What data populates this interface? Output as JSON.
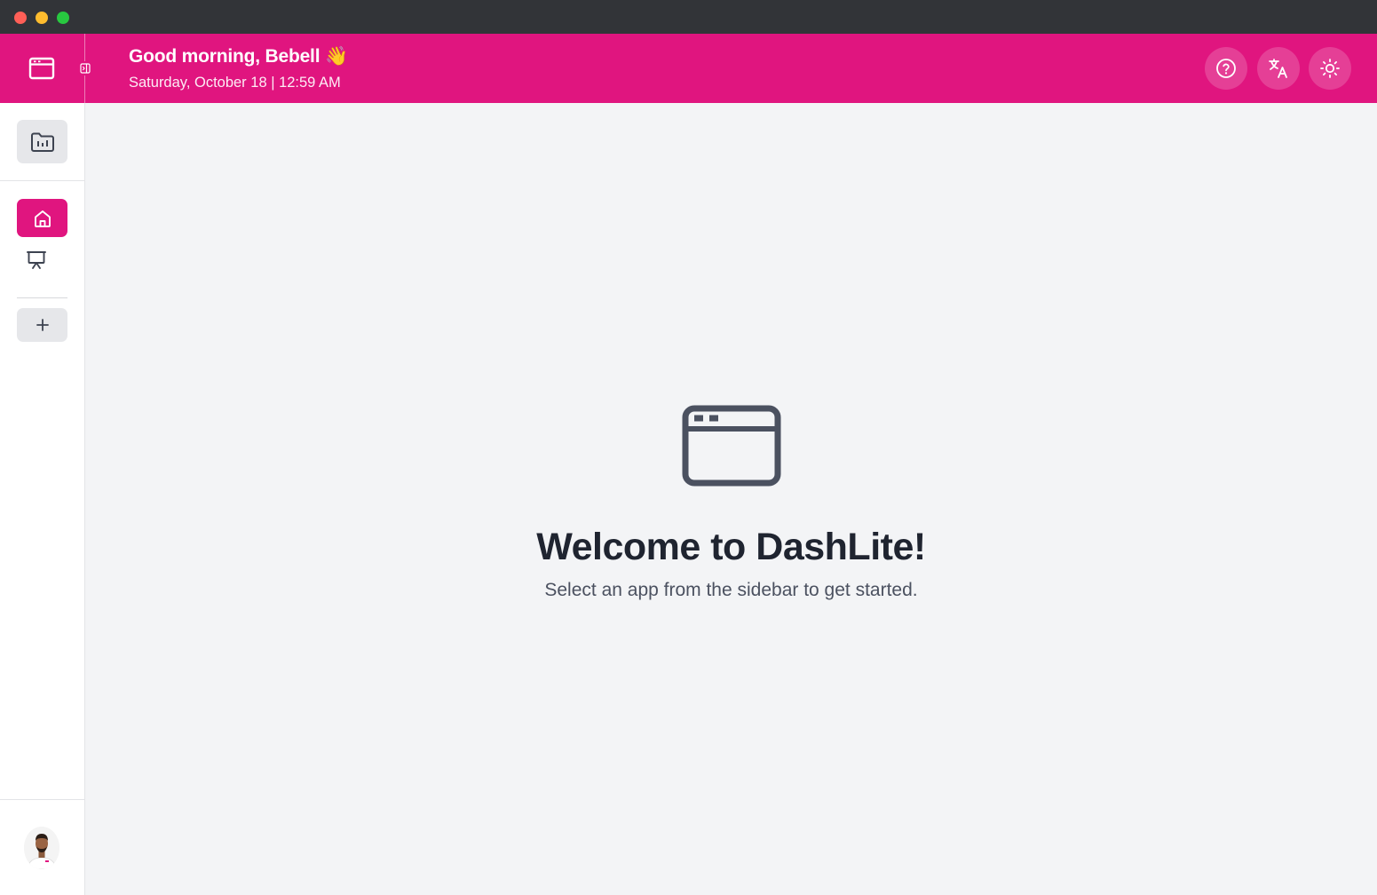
{
  "titlebar": {
    "buttons": [
      "close",
      "minimize",
      "maximize"
    ]
  },
  "header": {
    "app_icon": "browser-window-icon",
    "collapse_icon": "sidebar-collapse-icon",
    "greeting": "Good morning, Bebell 👋",
    "datetime": "Saturday, October 18 | 12:59 AM",
    "actions": [
      {
        "icon": "help-circle-icon"
      },
      {
        "icon": "translate-icon"
      },
      {
        "icon": "sun-icon"
      }
    ],
    "color": "#e0157f"
  },
  "sidebar": {
    "items": [
      {
        "icon": "folder-chart-icon"
      },
      {
        "icon": "home-icon",
        "active": true
      },
      {
        "icon": "presentation-icon"
      },
      {
        "icon": "plus-icon"
      }
    ],
    "avatar": "user-avatar"
  },
  "main": {
    "icon": "browser-window-icon",
    "title": "Welcome to DashLite!",
    "subtitle": "Select an app from the sidebar to get started."
  }
}
